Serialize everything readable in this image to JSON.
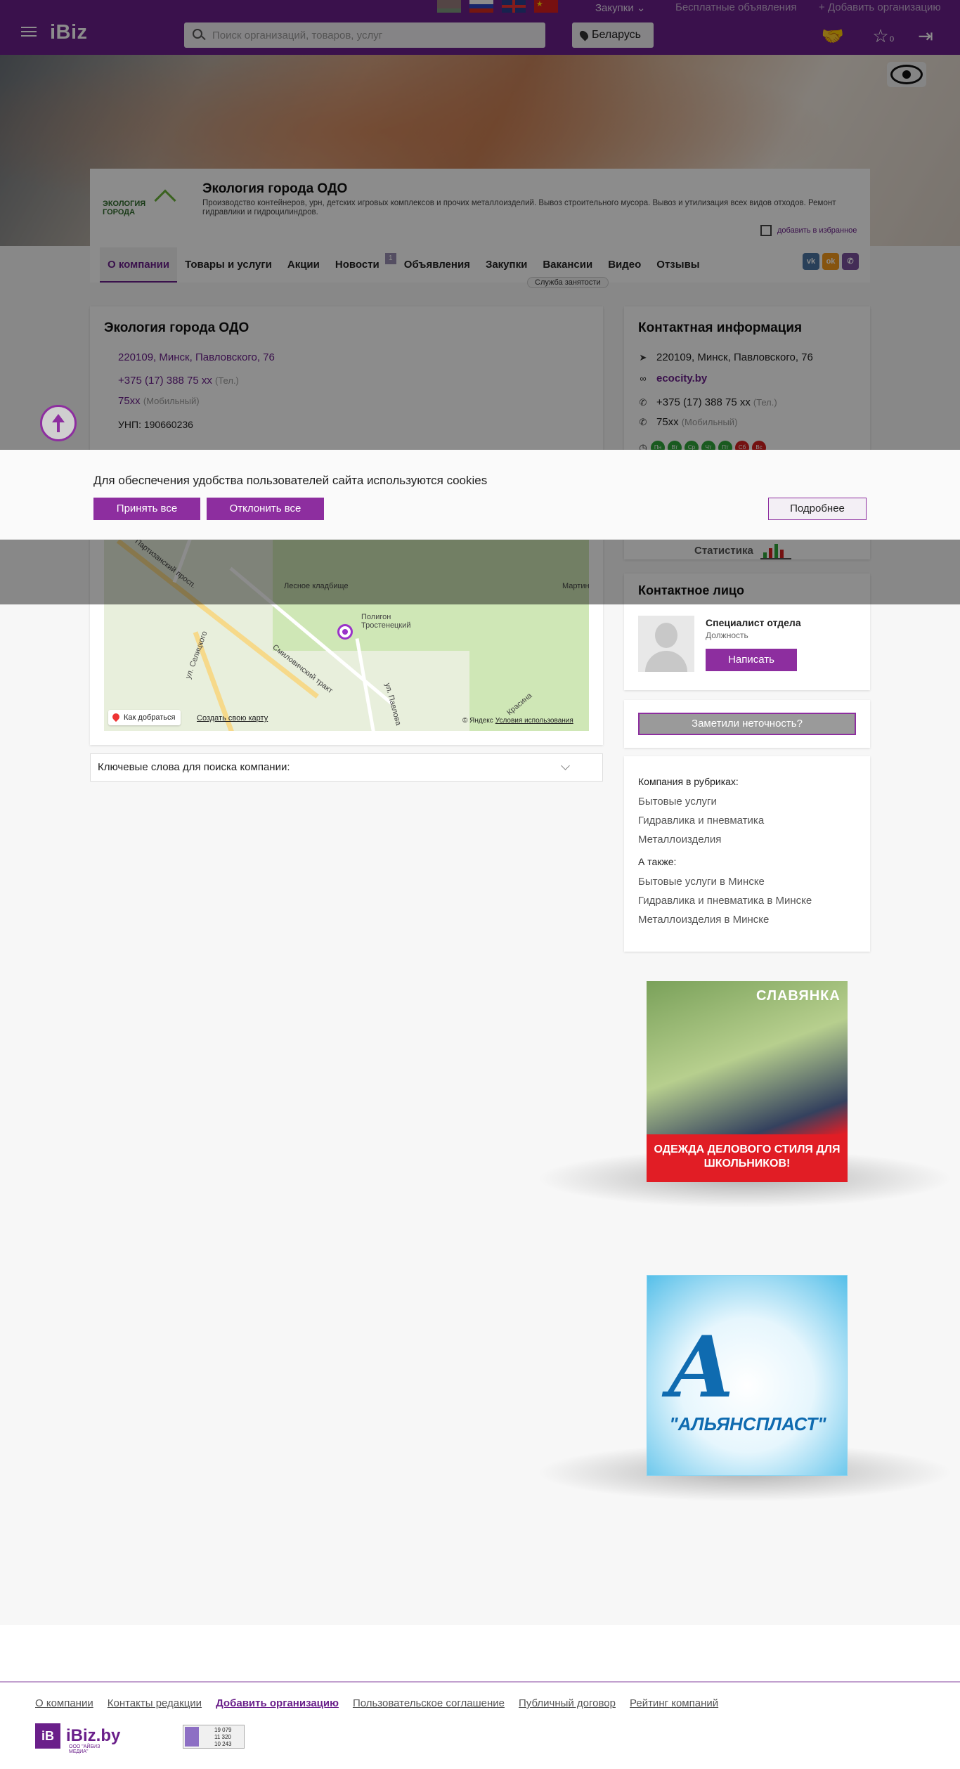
{
  "header": {
    "logo": "iBiz",
    "purchases": "Закупки",
    "free_ads": "Бесплатные объявления",
    "add_org": "+ Добавить организацию",
    "search_placeholder": "Поиск организаций, товаров, услуг",
    "region": "Беларусь",
    "favorites_count": "0",
    "languages": [
      "by",
      "ru",
      "en",
      "zh"
    ]
  },
  "company": {
    "title": "Экология города ОДО",
    "logo_text": "ЭКОЛОГИЯ ГОРОДА",
    "description": "Производство контейнеров, урн, детских игровых комплексов и прочих металлоизделий. Вывоз строительного мусора. Вывоз и утилизация всех видов отходов. Ремонт гидравлики и гидроцилиндров.",
    "add_favorite": "добавить в избранное"
  },
  "tabs": [
    {
      "label": "О компании",
      "active": true
    },
    {
      "label": "Товары и услуги"
    },
    {
      "label": "Акции"
    },
    {
      "label": "Новости",
      "badge": "1"
    },
    {
      "label": "Объявления"
    },
    {
      "label": "Закупки"
    },
    {
      "label": "Вакансии"
    },
    {
      "label": "Видео"
    },
    {
      "label": "Отзывы"
    }
  ],
  "employment_badge": "Служба занятости",
  "socials": [
    "vk",
    "ok",
    "viber"
  ],
  "main": {
    "title": "Экология города ОДО",
    "address": "220109, Минск, Павловского, 76",
    "phone1": "+375 (17) 388 75 xx",
    "phone1_type": "(Тел.)",
    "phone2": "75xx",
    "phone2_type": "(Мобильный)",
    "unp": "УНП: 190660236"
  },
  "map": {
    "labels": {
      "street1": "Партизанский просп.",
      "cemetery": "Лесное кладбище",
      "landfill": "Полигон Тростенецкий",
      "street2": "Смиловичский тракт",
      "street3": "ул. Селицкого",
      "street4": "ул. Павлова",
      "street5": "Красина",
      "martin": "Мартин"
    },
    "route": "Как добраться",
    "create": "Создать свою карту",
    "copyright": "© Яндекс",
    "terms": "Условия использования"
  },
  "keywords": "Ключевые слова для поиска компании:",
  "contact": {
    "title": "Контактная информация",
    "address": "220109, Минск, Павловского, 76",
    "site": "ecocity.by",
    "phone1": "+375 (17) 388 75 xx",
    "phone1_type": "(Тел.)",
    "phone2": "75xx",
    "phone2_type": "(Мобильный)",
    "days": [
      {
        "d": "Пн",
        "work": true
      },
      {
        "d": "Вт",
        "work": true
      },
      {
        "d": "Ср",
        "work": true
      },
      {
        "d": "Чт",
        "work": true
      },
      {
        "d": "Пт",
        "work": true
      },
      {
        "d": "Сб",
        "work": false
      },
      {
        "d": "Вс",
        "work": false
      }
    ],
    "stats": "Статистика"
  },
  "person": {
    "title": "Контактное лицо",
    "name": "Специалист отдела",
    "role": "Должность",
    "write": "Написать"
  },
  "report": "Заметили неточность?",
  "rubrics": {
    "title": "Компания в рубриках:",
    "items": [
      "Бытовые услуги",
      "Гидравлика и пневматика",
      "Металлоизделия"
    ],
    "also_title": "А также:",
    "also": [
      "Бытовые услуги в Минске",
      "Гидравлика и пневматика в Минске",
      "Металлоизделия в Минске"
    ]
  },
  "ads": {
    "ad1_brand": "СЛАВЯНКА",
    "ad1_slogan": "ОДЕЖДА ДЕЛОВОГО СТИЛЯ ДЛЯ ШКОЛЬНИКОВ!",
    "ad2_name": "\"АЛЬЯНСПЛАСТ\""
  },
  "cookie": {
    "text": "Для обеспечения удобства пользователей сайта используются cookies",
    "accept": "Принять все",
    "reject": "Отклонить все",
    "more": "Подробнее"
  },
  "footer": {
    "links": [
      "О компании",
      "Контакты редакции",
      "Добавить организацию",
      "Пользовательское соглашение",
      "Публичный договор",
      "Рейтинг компаний"
    ],
    "logo_box": "iB",
    "logo_text": "iBiz.by",
    "logo_sub": "ООО \"АЙБИЗ МЕДИА\"",
    "counter": [
      "19 079",
      "11 320",
      "10 243"
    ]
  },
  "colors": {
    "brand": "#6a1f8a",
    "button": "#8d2e9f",
    "work_day": "#2ea43a",
    "off_day": "#d42020"
  }
}
